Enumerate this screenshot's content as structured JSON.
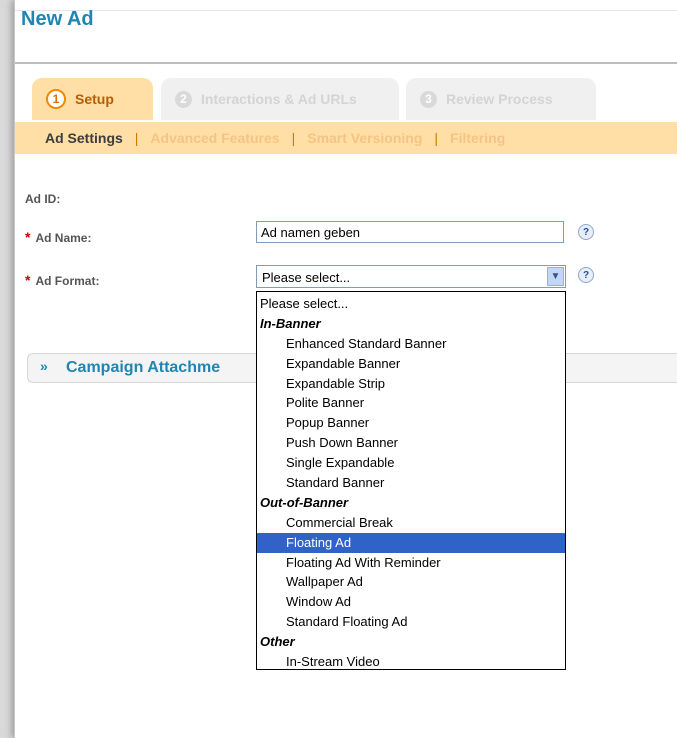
{
  "page": {
    "title": "New Ad"
  },
  "tabs": [
    {
      "number": "1",
      "label": "Setup"
    },
    {
      "number": "2",
      "label": "Interactions & Ad URLs"
    },
    {
      "number": "3",
      "label": "Review Process"
    }
  ],
  "subnav": {
    "active": "Ad Settings",
    "separator": "|",
    "links": [
      "Advanced Features",
      "Smart Versioning",
      "Filtering"
    ]
  },
  "form": {
    "ad_id_label": "Ad ID:",
    "required_mark": "*",
    "ad_name_label": "Ad Name:",
    "ad_name_value": "Ad namen geben",
    "ad_format_label": "Ad Format:",
    "ad_format_value": "Please select...",
    "help_glyph": "?"
  },
  "campaign": {
    "chevron": "»",
    "title": "Campaign Attachme"
  },
  "dropdown": {
    "options": [
      {
        "label": "Please select...",
        "kind": "option"
      },
      {
        "label": "In-Banner",
        "kind": "group"
      },
      {
        "label": "Enhanced Standard Banner",
        "kind": "child"
      },
      {
        "label": "Expandable Banner",
        "kind": "child"
      },
      {
        "label": "Expandable Strip",
        "kind": "child"
      },
      {
        "label": "Polite Banner",
        "kind": "child"
      },
      {
        "label": "Popup Banner",
        "kind": "child"
      },
      {
        "label": "Push Down Banner",
        "kind": "child"
      },
      {
        "label": "Single Expandable",
        "kind": "child"
      },
      {
        "label": "Standard Banner",
        "kind": "child"
      },
      {
        "label": "Out-of-Banner",
        "kind": "group"
      },
      {
        "label": "Commercial Break",
        "kind": "child"
      },
      {
        "label": "Floating Ad",
        "kind": "child",
        "selected": true
      },
      {
        "label": "Floating Ad With Reminder",
        "kind": "child"
      },
      {
        "label": "Wallpaper Ad",
        "kind": "child"
      },
      {
        "label": "Window Ad",
        "kind": "child"
      },
      {
        "label": "Standard Floating Ad",
        "kind": "child"
      },
      {
        "label": "Other",
        "kind": "group"
      },
      {
        "label": "In-Stream Video",
        "kind": "child"
      }
    ]
  },
  "colors": {
    "title_blue": "#1f86b3",
    "tab_active_bg": "#ffdfa6",
    "selection_blue": "#3162c8"
  }
}
